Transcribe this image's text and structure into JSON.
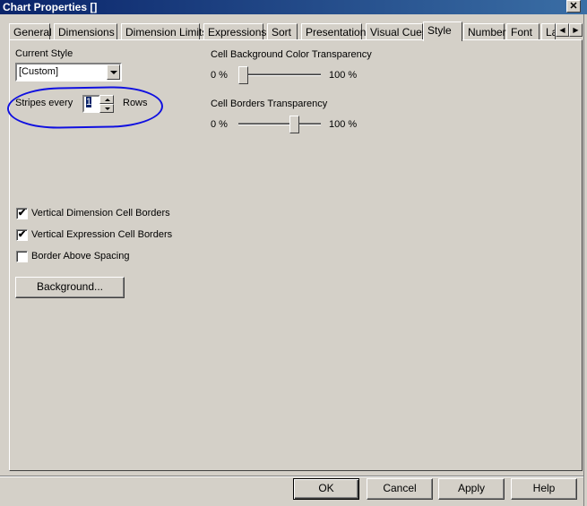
{
  "window": {
    "title": "Chart Properties []",
    "close_label": "✕"
  },
  "tabs": [
    {
      "label": "General"
    },
    {
      "label": "Dimensions"
    },
    {
      "label": "Dimension Limits"
    },
    {
      "label": "Expressions"
    },
    {
      "label": "Sort"
    },
    {
      "label": "Presentation"
    },
    {
      "label": "Visual Cues"
    },
    {
      "label": "Style",
      "active": true
    },
    {
      "label": "Number"
    },
    {
      "label": "Font"
    },
    {
      "label": "La"
    }
  ],
  "style_panel": {
    "current_style_label": "Current Style",
    "current_style_value": "[Custom]",
    "stripes_label": "Stripes every",
    "stripes_value": "1",
    "rows_label": "Rows",
    "bg_transparency_label": "Cell Background Color Transparency",
    "bg_transparency_min": "0 %",
    "bg_transparency_max": "100 %",
    "bg_transparency_value": 0,
    "border_transparency_label": "Cell Borders Transparency",
    "border_transparency_min": "0 %",
    "border_transparency_max": "100 %",
    "border_transparency_value": 0.7,
    "checkboxes": [
      {
        "label": "Vertical Dimension Cell Borders",
        "checked": true
      },
      {
        "label": "Vertical Expression Cell Borders",
        "checked": true
      },
      {
        "label": "Border Above Spacing",
        "checked": false
      }
    ],
    "background_button": "Background..."
  },
  "footer": {
    "ok": "OK",
    "cancel": "Cancel",
    "apply": "Apply",
    "help": "Help"
  },
  "colors": {
    "annotation": "#1010e0",
    "title_bar": "#0a246a",
    "dialog_bg": "#d4d0c8"
  }
}
